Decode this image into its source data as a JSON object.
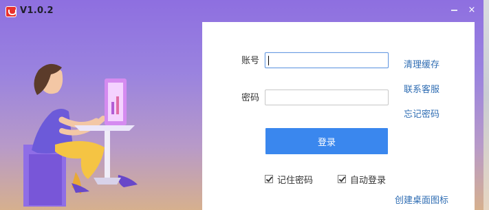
{
  "window": {
    "title": "V1.0.2",
    "minimize_label": "minimize",
    "close_label": "×"
  },
  "login": {
    "account_label": "账号",
    "account_value": "",
    "password_label": "密码",
    "password_value": "",
    "submit_label": "登录",
    "remember_password_label": "记住密码",
    "remember_password_checked": true,
    "auto_login_label": "自动登录",
    "auto_login_checked": true
  },
  "links": {
    "clear_cache": "清理缓存",
    "contact_support": "联系客服",
    "forgot_password": "忘记密码",
    "create_shortcut": "创建桌面图标"
  },
  "colors": {
    "window_gradient_top": "#8e6fe0",
    "window_gradient_bottom": "#d6b08e",
    "accent": "#3a87ee",
    "link": "#2f6db3",
    "app_icon": "#e8312f"
  },
  "icons": {
    "app": "app-logo-icon",
    "minimize": "minimize-icon",
    "close": "close-icon"
  }
}
